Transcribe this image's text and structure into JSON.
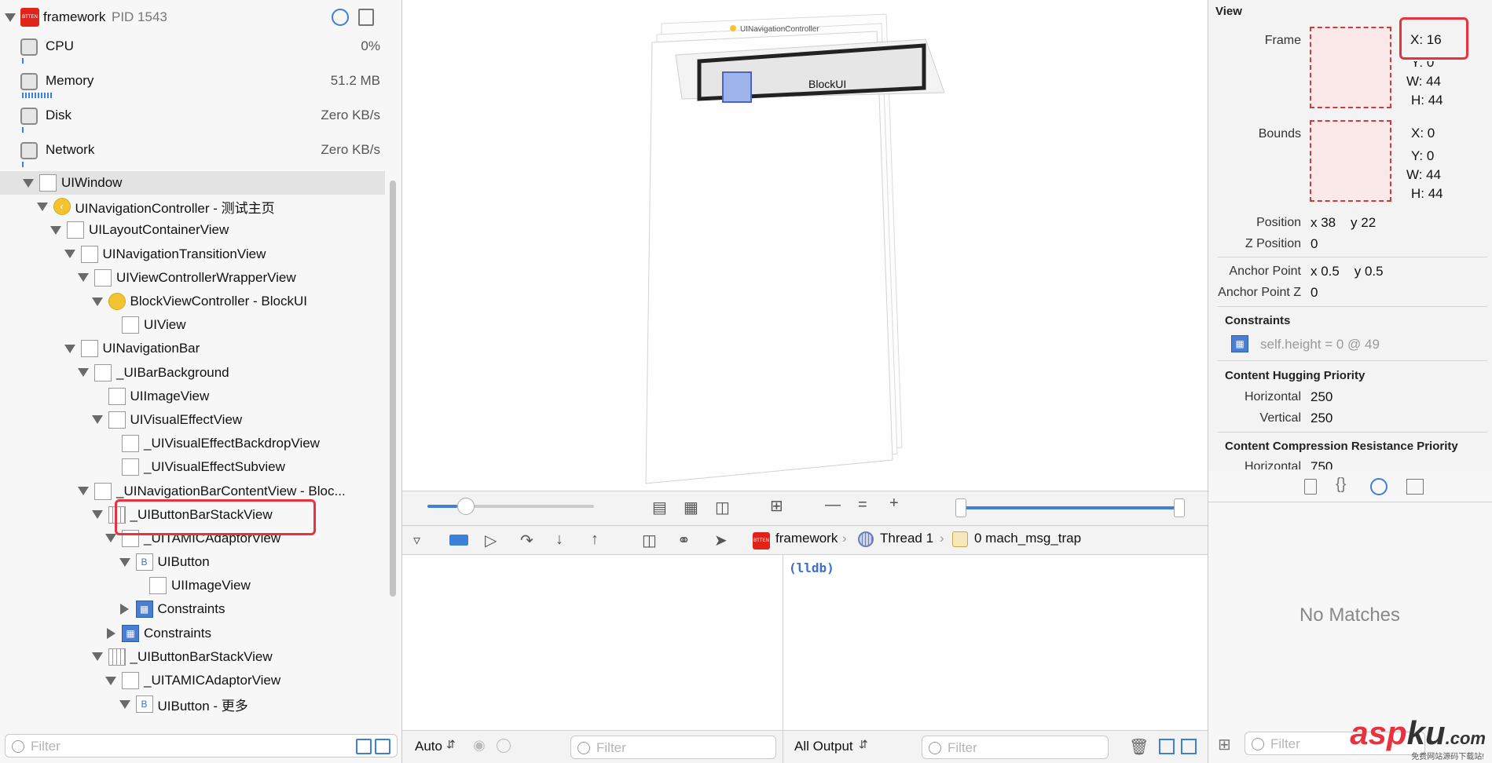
{
  "process": {
    "name": "framework",
    "pid": "PID 1543",
    "badge": "BTTEN"
  },
  "gauges": [
    {
      "label": "CPU",
      "value": "0%",
      "level": 0.0
    },
    {
      "label": "Memory",
      "value": "51.2 MB",
      "level": 0.33
    },
    {
      "label": "Disk",
      "value": "Zero KB/s",
      "level": 0.0
    },
    {
      "label": "Network",
      "value": "Zero KB/s",
      "level": 0.0
    }
  ],
  "tree": [
    {
      "label": "UIWindow",
      "depth": 0,
      "disclosure": "open",
      "icon": "view"
    },
    {
      "label": "UINavigationController - 测试主页",
      "depth": 1,
      "disclosure": "open",
      "icon": "nav-controller"
    },
    {
      "label": "UILayoutContainerView",
      "depth": 2,
      "disclosure": "open",
      "icon": "view"
    },
    {
      "label": "UINavigationTransitionView",
      "depth": 3,
      "disclosure": "open",
      "icon": "view"
    },
    {
      "label": "UIViewControllerWrapperView",
      "depth": 4,
      "disclosure": "open",
      "icon": "view"
    },
    {
      "label": "BlockViewController - BlockUI",
      "depth": 5,
      "disclosure": "open",
      "icon": "view-controller"
    },
    {
      "label": "UIView",
      "depth": 6,
      "disclosure": "none",
      "icon": "view"
    },
    {
      "label": "UINavigationBar",
      "depth": 3,
      "disclosure": "open",
      "icon": "navbar"
    },
    {
      "label": "_UIBarBackground",
      "depth": 4,
      "disclosure": "open",
      "icon": "view"
    },
    {
      "label": "UIImageView",
      "depth": 5,
      "disclosure": "none",
      "icon": "image"
    },
    {
      "label": "UIVisualEffectView",
      "depth": 5,
      "disclosure": "open",
      "icon": "view"
    },
    {
      "label": "_UIVisualEffectBackdropView",
      "depth": 6,
      "disclosure": "none",
      "icon": "view"
    },
    {
      "label": "_UIVisualEffectSubview",
      "depth": 6,
      "disclosure": "none",
      "icon": "view"
    },
    {
      "label": "_UINavigationBarContentView - Bloc...",
      "depth": 4,
      "disclosure": "open",
      "icon": "view"
    },
    {
      "label": "_UIButtonBarStackView",
      "depth": 5,
      "disclosure": "open",
      "icon": "stack"
    },
    {
      "label": "_UITAMICAdaptorView",
      "depth": 6,
      "disclosure": "open",
      "icon": "view"
    },
    {
      "label": "UIButton",
      "depth": 7,
      "disclosure": "open",
      "icon": "button"
    },
    {
      "label": "UIImageView",
      "depth": 8,
      "disclosure": "none",
      "icon": "image"
    },
    {
      "label": "Constraints",
      "depth": 7,
      "disclosure": "closed",
      "icon": "constraints"
    },
    {
      "label": "Constraints",
      "depth": 6,
      "disclosure": "closed",
      "icon": "constraints"
    },
    {
      "label": "_UIButtonBarStackView",
      "depth": 5,
      "disclosure": "open",
      "icon": "stack"
    },
    {
      "label": "_UITAMICAdaptorView",
      "depth": 6,
      "disclosure": "open",
      "icon": "view"
    },
    {
      "label": "UIButton - 更多",
      "depth": 7,
      "disclosure": "open",
      "icon": "button"
    }
  ],
  "left_filter": {
    "placeholder": "Filter"
  },
  "canvas": {
    "nav_controller_label": "UINavigationController",
    "block_label": "BlockUI",
    "zoom_level": 0.12
  },
  "debug": {
    "breadcrumb": [
      "framework",
      "Thread 1",
      "0 mach_msg_trap"
    ],
    "console_prompt": "(lldb)",
    "auto_label": "Auto",
    "output_label": "All Output",
    "filter_placeholder": "Filter"
  },
  "inspector": {
    "section": "View",
    "frame": {
      "label": "Frame",
      "x": "X: 16",
      "y": "Y: 0",
      "w": "W: 44",
      "h": "H: 44"
    },
    "bounds": {
      "label": "Bounds",
      "x": "X: 0",
      "y": "Y: 0",
      "w": "W: 44",
      "h": "H: 44"
    },
    "position": {
      "label": "Position",
      "value": "x 38    y 22"
    },
    "z_position": {
      "label": "Z Position",
      "value": "0"
    },
    "anchor_point": {
      "label": "Anchor Point",
      "value": "x 0.5    y 0.5"
    },
    "anchor_point_z": {
      "label": "Anchor Point Z",
      "value": "0"
    },
    "constraints": {
      "title": "Constraints",
      "item": "self.height = 0 @ 49"
    },
    "hugging": {
      "title": "Content Hugging Priority",
      "h_label": "Horizontal",
      "h_value": "250",
      "v_label": "Vertical",
      "v_value": "250"
    },
    "compression": {
      "title": "Content Compression Resistance Priority",
      "h_label": "Horizontal",
      "h_value": "750"
    }
  },
  "library": {
    "empty_text": "No Matches",
    "filter_placeholder": "Filter"
  },
  "watermark": {
    "brand_a": "asp",
    "brand_b": "ku",
    "brand_c": ".com",
    "sub": "免费网站源码下载站!"
  },
  "colors": {
    "highlight": "#e8333f",
    "accent": "#3d7fd9"
  }
}
